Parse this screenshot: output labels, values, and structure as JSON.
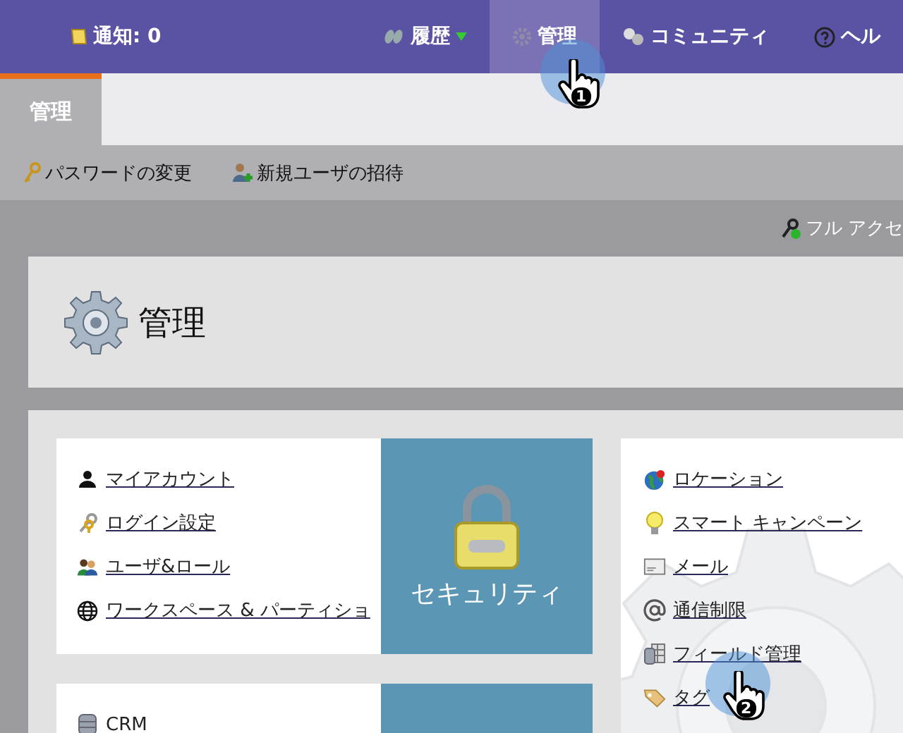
{
  "top_nav": {
    "notifications": "通知: 0",
    "items": [
      {
        "label": "履歴",
        "kind": "dropdown",
        "selected": false
      },
      {
        "label": "管理",
        "kind": "gear",
        "selected": true
      },
      {
        "label": "コミュニティ",
        "kind": "community",
        "selected": false
      },
      {
        "label": "ヘル",
        "kind": "help",
        "selected": false
      }
    ]
  },
  "tabs": [
    {
      "label": "管理",
      "selected": true
    }
  ],
  "toolbar": [
    {
      "label": "パスワードの変更",
      "kind": "key"
    },
    {
      "label": "新規ユーザの招待",
      "kind": "add-user"
    }
  ],
  "access": "フル アクセ",
  "page_title": "管理",
  "sections": [
    {
      "title": "セキュリティ",
      "kind": "lock",
      "links": [
        {
          "label": "マイアカウント",
          "kind": "person"
        },
        {
          "label": "ログイン設定",
          "kind": "keys"
        },
        {
          "label": "ユーザ&ロール",
          "kind": "users"
        },
        {
          "label": "ワークスペース & パーティショ",
          "kind": "globe"
        }
      ]
    },
    {
      "kind": "plain",
      "links": [
        {
          "label": "CRM",
          "kind": "database"
        }
      ]
    }
  ],
  "right_links": [
    {
      "label": "ロケーション",
      "kind": "earth"
    },
    {
      "label": "スマート キャンペーン",
      "kind": "bulb"
    },
    {
      "label": "メール",
      "kind": "mail"
    },
    {
      "label": "通信制限",
      "kind": "at"
    },
    {
      "label": "フィールド管理",
      "kind": "fields"
    },
    {
      "label": "タグ",
      "kind": "tag"
    }
  ],
  "step_markers": [
    {
      "label": "1"
    },
    {
      "label": "2"
    }
  ]
}
